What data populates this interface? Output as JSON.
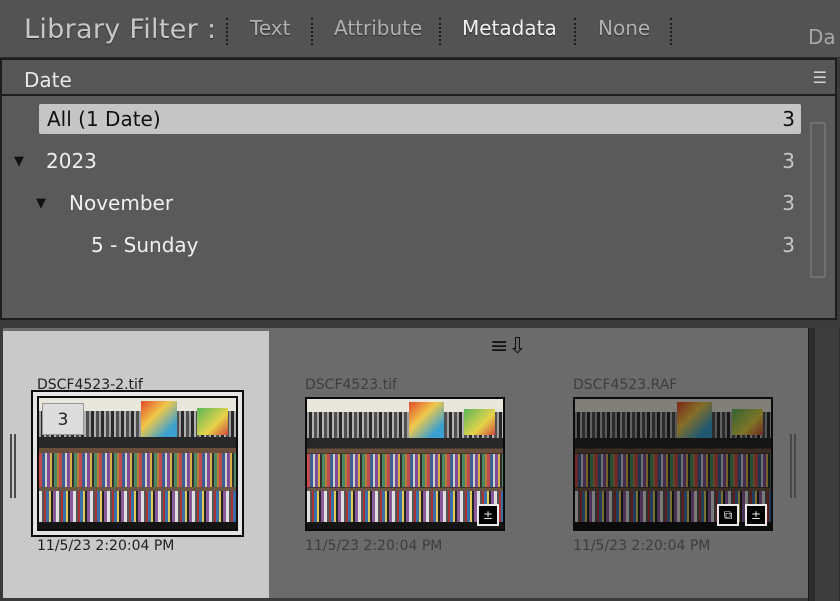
{
  "filter_bar": {
    "title": "Library Filter :",
    "tabs": [
      {
        "label": "Text",
        "active": false
      },
      {
        "label": "Attribute",
        "active": false
      },
      {
        "label": "Metadata",
        "active": true
      },
      {
        "label": "None",
        "active": false
      }
    ],
    "cut_label": "Da"
  },
  "date_column": {
    "header": "Date",
    "menu_icon": "column-menu-icon",
    "rows": [
      {
        "label": "All (1 Date)",
        "count": "3",
        "selected": true
      },
      {
        "label": "2023",
        "count": "3",
        "expanded": true
      },
      {
        "label": "November",
        "count": "3",
        "expanded": true
      },
      {
        "label": "5 - Sunday",
        "count": "3"
      }
    ]
  },
  "grid": {
    "sort_icon": "sort-direction-icon",
    "items": [
      {
        "filename": "DSCF4523-2.tif",
        "datetime": "11/5/23 2:20:04 PM",
        "stack_count": "3",
        "selected": true
      },
      {
        "filename": "DSCF4523.tif",
        "datetime": "11/5/23 2:20:04 PM",
        "badges": [
          "develop-adjustments-icon"
        ]
      },
      {
        "filename": "DSCF4523.RAF",
        "datetime": "11/5/23 2:20:04 PM",
        "badges": [
          "virtual-copy-icon",
          "develop-adjustments-icon"
        ]
      }
    ]
  }
}
